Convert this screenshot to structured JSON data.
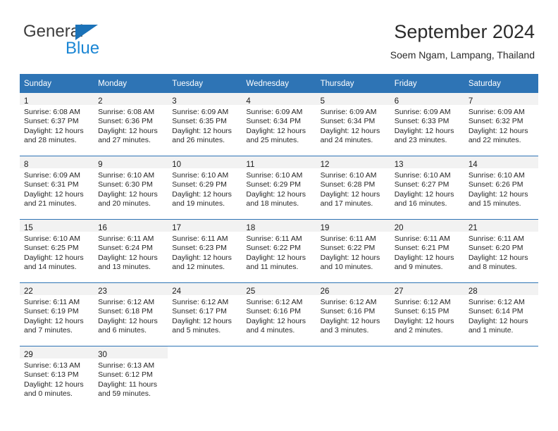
{
  "brand": {
    "name_top": "General",
    "name_bottom": "Blue",
    "triangle_color": "#1b72b8",
    "top_color": "#3d3d3d",
    "bottom_color": "#1b86d4"
  },
  "header": {
    "title": "September 2024",
    "subtitle": "Soem Ngam, Lampang, Thailand",
    "accent_color": "#2e74b5",
    "daynum_band_color": "#f2f2f2"
  },
  "weekdays": [
    "Sunday",
    "Monday",
    "Tuesday",
    "Wednesday",
    "Thursday",
    "Friday",
    "Saturday"
  ],
  "weeks": [
    [
      {
        "day": "1",
        "sunrise": "Sunrise: 6:08 AM",
        "sunset": "Sunset: 6:37 PM",
        "daylight1": "Daylight: 12 hours",
        "daylight2": "and 28 minutes."
      },
      {
        "day": "2",
        "sunrise": "Sunrise: 6:08 AM",
        "sunset": "Sunset: 6:36 PM",
        "daylight1": "Daylight: 12 hours",
        "daylight2": "and 27 minutes."
      },
      {
        "day": "3",
        "sunrise": "Sunrise: 6:09 AM",
        "sunset": "Sunset: 6:35 PM",
        "daylight1": "Daylight: 12 hours",
        "daylight2": "and 26 minutes."
      },
      {
        "day": "4",
        "sunrise": "Sunrise: 6:09 AM",
        "sunset": "Sunset: 6:34 PM",
        "daylight1": "Daylight: 12 hours",
        "daylight2": "and 25 minutes."
      },
      {
        "day": "5",
        "sunrise": "Sunrise: 6:09 AM",
        "sunset": "Sunset: 6:34 PM",
        "daylight1": "Daylight: 12 hours",
        "daylight2": "and 24 minutes."
      },
      {
        "day": "6",
        "sunrise": "Sunrise: 6:09 AM",
        "sunset": "Sunset: 6:33 PM",
        "daylight1": "Daylight: 12 hours",
        "daylight2": "and 23 minutes."
      },
      {
        "day": "7",
        "sunrise": "Sunrise: 6:09 AM",
        "sunset": "Sunset: 6:32 PM",
        "daylight1": "Daylight: 12 hours",
        "daylight2": "and 22 minutes."
      }
    ],
    [
      {
        "day": "8",
        "sunrise": "Sunrise: 6:09 AM",
        "sunset": "Sunset: 6:31 PM",
        "daylight1": "Daylight: 12 hours",
        "daylight2": "and 21 minutes."
      },
      {
        "day": "9",
        "sunrise": "Sunrise: 6:10 AM",
        "sunset": "Sunset: 6:30 PM",
        "daylight1": "Daylight: 12 hours",
        "daylight2": "and 20 minutes."
      },
      {
        "day": "10",
        "sunrise": "Sunrise: 6:10 AM",
        "sunset": "Sunset: 6:29 PM",
        "daylight1": "Daylight: 12 hours",
        "daylight2": "and 19 minutes."
      },
      {
        "day": "11",
        "sunrise": "Sunrise: 6:10 AM",
        "sunset": "Sunset: 6:29 PM",
        "daylight1": "Daylight: 12 hours",
        "daylight2": "and 18 minutes."
      },
      {
        "day": "12",
        "sunrise": "Sunrise: 6:10 AM",
        "sunset": "Sunset: 6:28 PM",
        "daylight1": "Daylight: 12 hours",
        "daylight2": "and 17 minutes."
      },
      {
        "day": "13",
        "sunrise": "Sunrise: 6:10 AM",
        "sunset": "Sunset: 6:27 PM",
        "daylight1": "Daylight: 12 hours",
        "daylight2": "and 16 minutes."
      },
      {
        "day": "14",
        "sunrise": "Sunrise: 6:10 AM",
        "sunset": "Sunset: 6:26 PM",
        "daylight1": "Daylight: 12 hours",
        "daylight2": "and 15 minutes."
      }
    ],
    [
      {
        "day": "15",
        "sunrise": "Sunrise: 6:10 AM",
        "sunset": "Sunset: 6:25 PM",
        "daylight1": "Daylight: 12 hours",
        "daylight2": "and 14 minutes."
      },
      {
        "day": "16",
        "sunrise": "Sunrise: 6:11 AM",
        "sunset": "Sunset: 6:24 PM",
        "daylight1": "Daylight: 12 hours",
        "daylight2": "and 13 minutes."
      },
      {
        "day": "17",
        "sunrise": "Sunrise: 6:11 AM",
        "sunset": "Sunset: 6:23 PM",
        "daylight1": "Daylight: 12 hours",
        "daylight2": "and 12 minutes."
      },
      {
        "day": "18",
        "sunrise": "Sunrise: 6:11 AM",
        "sunset": "Sunset: 6:22 PM",
        "daylight1": "Daylight: 12 hours",
        "daylight2": "and 11 minutes."
      },
      {
        "day": "19",
        "sunrise": "Sunrise: 6:11 AM",
        "sunset": "Sunset: 6:22 PM",
        "daylight1": "Daylight: 12 hours",
        "daylight2": "and 10 minutes."
      },
      {
        "day": "20",
        "sunrise": "Sunrise: 6:11 AM",
        "sunset": "Sunset: 6:21 PM",
        "daylight1": "Daylight: 12 hours",
        "daylight2": "and 9 minutes."
      },
      {
        "day": "21",
        "sunrise": "Sunrise: 6:11 AM",
        "sunset": "Sunset: 6:20 PM",
        "daylight1": "Daylight: 12 hours",
        "daylight2": "and 8 minutes."
      }
    ],
    [
      {
        "day": "22",
        "sunrise": "Sunrise: 6:11 AM",
        "sunset": "Sunset: 6:19 PM",
        "daylight1": "Daylight: 12 hours",
        "daylight2": "and 7 minutes."
      },
      {
        "day": "23",
        "sunrise": "Sunrise: 6:12 AM",
        "sunset": "Sunset: 6:18 PM",
        "daylight1": "Daylight: 12 hours",
        "daylight2": "and 6 minutes."
      },
      {
        "day": "24",
        "sunrise": "Sunrise: 6:12 AM",
        "sunset": "Sunset: 6:17 PM",
        "daylight1": "Daylight: 12 hours",
        "daylight2": "and 5 minutes."
      },
      {
        "day": "25",
        "sunrise": "Sunrise: 6:12 AM",
        "sunset": "Sunset: 6:16 PM",
        "daylight1": "Daylight: 12 hours",
        "daylight2": "and 4 minutes."
      },
      {
        "day": "26",
        "sunrise": "Sunrise: 6:12 AM",
        "sunset": "Sunset: 6:16 PM",
        "daylight1": "Daylight: 12 hours",
        "daylight2": "and 3 minutes."
      },
      {
        "day": "27",
        "sunrise": "Sunrise: 6:12 AM",
        "sunset": "Sunset: 6:15 PM",
        "daylight1": "Daylight: 12 hours",
        "daylight2": "and 2 minutes."
      },
      {
        "day": "28",
        "sunrise": "Sunrise: 6:12 AM",
        "sunset": "Sunset: 6:14 PM",
        "daylight1": "Daylight: 12 hours",
        "daylight2": "and 1 minute."
      }
    ],
    [
      {
        "day": "29",
        "sunrise": "Sunrise: 6:13 AM",
        "sunset": "Sunset: 6:13 PM",
        "daylight1": "Daylight: 12 hours",
        "daylight2": "and 0 minutes."
      },
      {
        "day": "30",
        "sunrise": "Sunrise: 6:13 AM",
        "sunset": "Sunset: 6:12 PM",
        "daylight1": "Daylight: 11 hours",
        "daylight2": "and 59 minutes."
      },
      {
        "day": "",
        "sunrise": "",
        "sunset": "",
        "daylight1": "",
        "daylight2": ""
      },
      {
        "day": "",
        "sunrise": "",
        "sunset": "",
        "daylight1": "",
        "daylight2": ""
      },
      {
        "day": "",
        "sunrise": "",
        "sunset": "",
        "daylight1": "",
        "daylight2": ""
      },
      {
        "day": "",
        "sunrise": "",
        "sunset": "",
        "daylight1": "",
        "daylight2": ""
      },
      {
        "day": "",
        "sunrise": "",
        "sunset": "",
        "daylight1": "",
        "daylight2": ""
      }
    ]
  ]
}
